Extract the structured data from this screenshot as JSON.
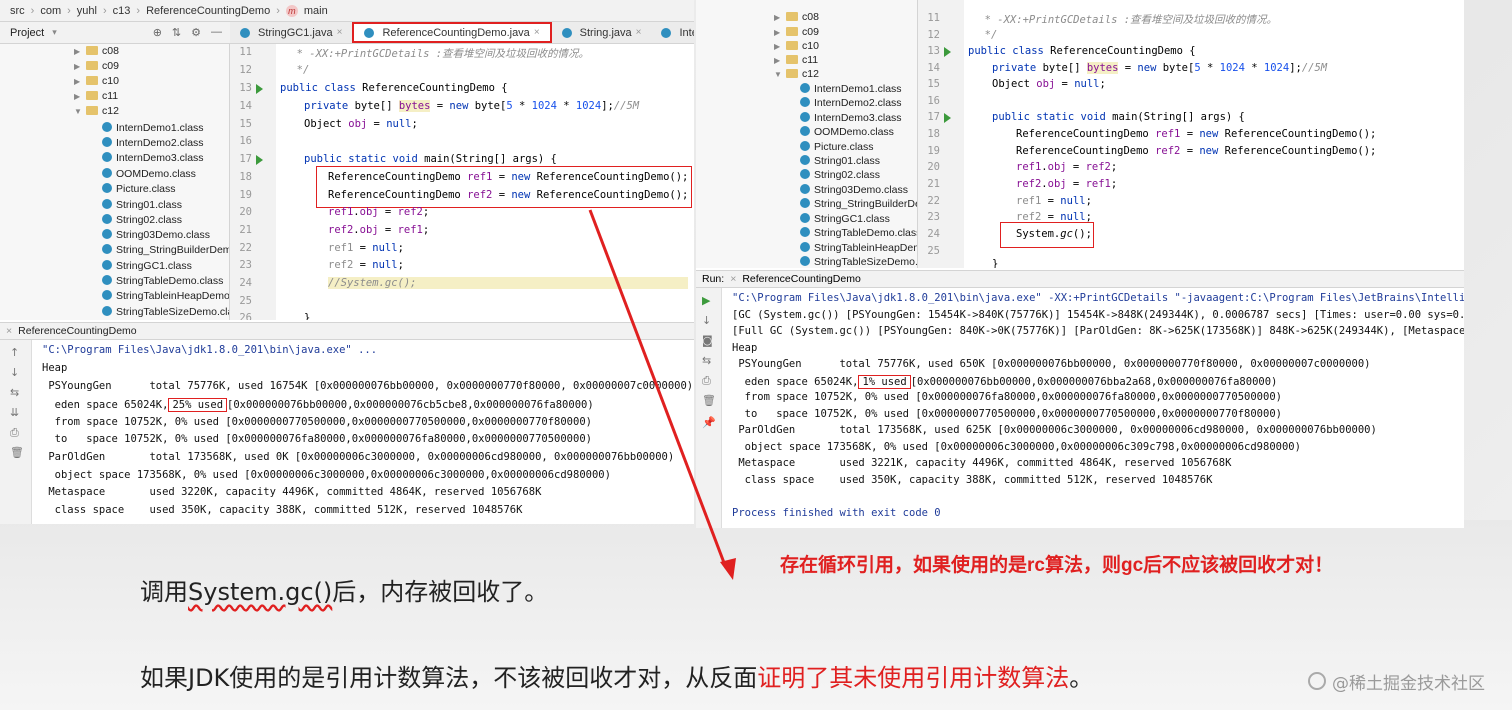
{
  "left": {
    "breadcrumb": [
      "src",
      "com",
      "yuhl",
      "c13",
      "ReferenceCountingDemo",
      "main"
    ],
    "project_label": "Project",
    "tabs": [
      "StringGC1.java",
      "ReferenceCountingDemo.java",
      "String.java",
      "Integer.java"
    ],
    "tree": {
      "folders": [
        "c08",
        "c09",
        "c10",
        "c11",
        "c12"
      ],
      "classes": [
        "InternDemo1.class",
        "InternDemo2.class",
        "InternDemo3.class",
        "OOMDemo.class",
        "Picture.class",
        "String01.class",
        "String02.class",
        "String03Demo.class",
        "String_StringBuilderDemo",
        "StringGC1.class",
        "StringTableDemo.class",
        "StringTableinHeapDemo.c",
        "StringTableSizeDemo.clas"
      ]
    },
    "line_numbers": [
      "11",
      "12",
      "13",
      "14",
      "15",
      "16",
      "17",
      "18",
      "19",
      "20",
      "21",
      "22",
      "23",
      "24",
      "25",
      "26"
    ],
    "run_title": "ReferenceCountingDemo",
    "console": [
      "\"C:\\Program Files\\Java\\jdk1.8.0_201\\bin\\java.exe\" ...",
      "Heap",
      " PSYoungGen      total 75776K, used 16754K [0x000000076bb00000, 0x0000000770f80000, 0x00000007c0000000)",
      "  eden space 65024K,",
      "25% used",
      "[0x000000076bb00000,0x000000076cb5cbe8,0x000000076fa80000)",
      "  from space 10752K, 0% used [0x0000000770500000,0x0000000770500000,0x0000000770f80000)",
      "  to   space 10752K, 0% used [0x000000076fa80000,0x000000076fa80000,0x0000000770500000)",
      " ParOldGen       total 173568K, used 0K [0x00000006c3000000, 0x00000006cd980000, 0x000000076bb00000)",
      "  object space 173568K, 0% used [0x00000006c3000000,0x00000006c3000000,0x00000006cd980000)",
      " Metaspace       used 3220K, capacity 4496K, committed 4864K, reserved 1056768K",
      "  class space    used 350K, capacity 388K, committed 512K, reserved 1048576K"
    ]
  },
  "right": {
    "tree": {
      "folders": [
        "c08",
        "c09",
        "c10",
        "c11",
        "c12"
      ],
      "classes": [
        "InternDemo1.class",
        "InternDemo2.class",
        "InternDemo3.class",
        "OOMDemo.class",
        "Picture.class",
        "String01.class",
        "String02.class",
        "String03Demo.class",
        "String_StringBuilderDemo",
        "StringGC1.class",
        "StringTableDemo.class",
        "StringTableinHeapDemo.cla",
        "StringTableSizeDemo.clas"
      ]
    },
    "line_numbers": [
      "11",
      "12",
      "13",
      "14",
      "15",
      "16",
      "17",
      "18",
      "19",
      "20",
      "21",
      "22",
      "23",
      "24",
      "25"
    ],
    "run_label": "Run:",
    "run_title": "ReferenceCountingDemo",
    "console": [
      "\"C:\\Program Files\\Java\\jdk1.8.0_201\\bin\\java.exe\" -XX:+PrintGCDetails \"-javaagent:C:\\Program Files\\JetBrains\\IntelliJ IDEA 2",
      "[GC (System.gc()) [PSYoungGen: 15454K->840K(75776K)] 15454K->848K(249344K), 0.0006787 secs] [Times: user=0.00 sys=0.00, real",
      "[Full GC (System.gc()) [PSYoungGen: 840K->0K(75776K)] [ParOldGen: 8K->625K(173568K)] 848K->625K(249344K), [Metaspace: 3214K-",
      "Heap",
      " PSYoungGen      total 75776K, used 650K [0x000000076bb00000, 0x0000000770f80000, 0x00000007c0000000)",
      "  eden space 65024K,",
      "1% used",
      "[0x000000076bb00000,0x000000076bba2a68,0x000000076fa80000)",
      "  from space 10752K, 0% used [0x000000076fa80000,0x000000076fa80000,0x0000000770500000)",
      "  to   space 10752K, 0% used [0x0000000770500000,0x0000000770500000,0x0000000770f80000)",
      " ParOldGen       total 173568K, used 625K [0x00000006c3000000, 0x00000006cd980000, 0x000000076bb00000)",
      "  object space 173568K, 0% used [0x00000006c3000000,0x00000006c309c798,0x00000006cd980000)",
      " Metaspace       used 3221K, capacity 4496K, committed 4864K, reserved 1056768K",
      "  class space    used 350K, capacity 388K, committed 512K, reserved 1048576K",
      "Process finished with exit code 0"
    ]
  },
  "annotations": {
    "red_claim": "存在循环引用，如果使用的是rc算法，则gc后不应该被回收才对！",
    "note1_a": "调用",
    "note1_b": "System.gc()",
    "note1_c": "后，内存被回收了。",
    "note2_a": "如果JDK使用的是引用计数算法，不该被回收才对，从反面",
    "note2_b": "证明了其未使用引用计数算法",
    "note2_c": "。",
    "watermark": "@稀土掘金技术社区"
  },
  "colors": {
    "accent_red": "#e02020",
    "keyword": "#0033b3",
    "field": "#871094",
    "comment": "#8c8c8c"
  }
}
